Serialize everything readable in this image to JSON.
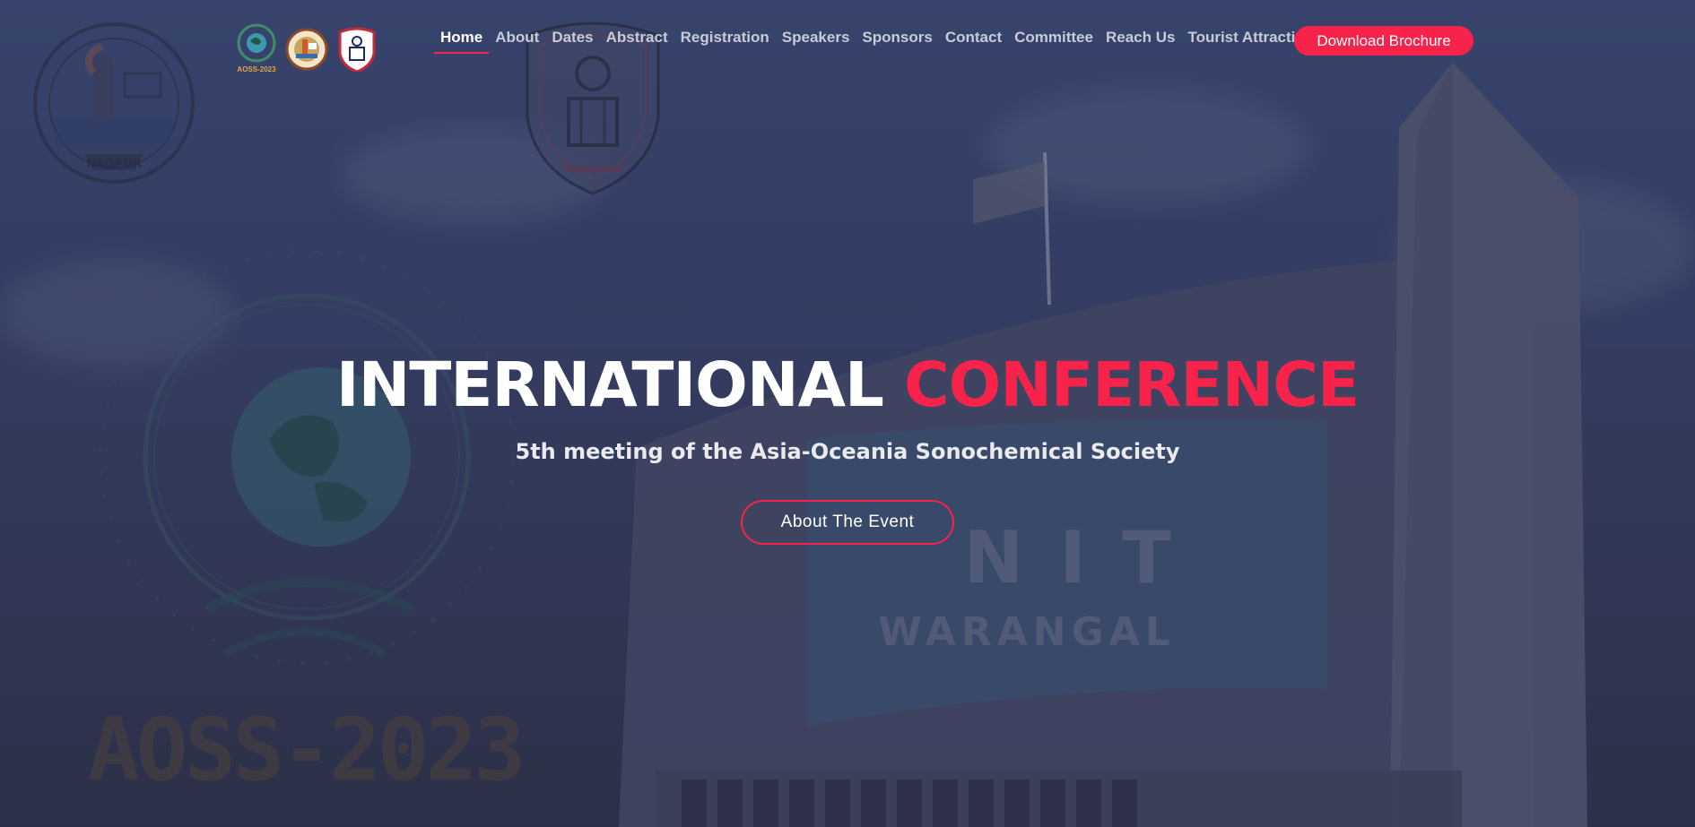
{
  "colors": {
    "accent": "#f7234a",
    "nav_text": "#c8cbd6",
    "nav_active": "#ffffff",
    "background": "#3a4670"
  },
  "background": {
    "watermark_text": "AOSS-2023",
    "building_sign_line1": "NIT",
    "building_sign_line2": "WARANGAL",
    "vnit_seal_lower": "NAGPUR",
    "nitw_shield_lower": "WARANGAL"
  },
  "logos": [
    {
      "name": "aoss-2023-logo-icon",
      "caption": "AOSS-2023"
    },
    {
      "name": "vnit-logo-icon"
    },
    {
      "name": "nitw-logo-icon"
    }
  ],
  "nav": {
    "items": [
      {
        "label": "Home",
        "active": true
      },
      {
        "label": "About"
      },
      {
        "label": "Dates"
      },
      {
        "label": "Abstract"
      },
      {
        "label": "Registration"
      },
      {
        "label": "Speakers"
      },
      {
        "label": "Sponsors"
      },
      {
        "label": "Contact"
      },
      {
        "label": "Committee"
      },
      {
        "label": "Reach Us"
      },
      {
        "label": "Tourist Attraction"
      }
    ],
    "cta_label": "Download Brochure"
  },
  "hero": {
    "title_part1": "INTERNATIONAL",
    "title_part2": "CONFERENCE",
    "subtitle": "5th meeting of the Asia-Oceania Sonochemical Society",
    "cta_label": "About The Event"
  }
}
